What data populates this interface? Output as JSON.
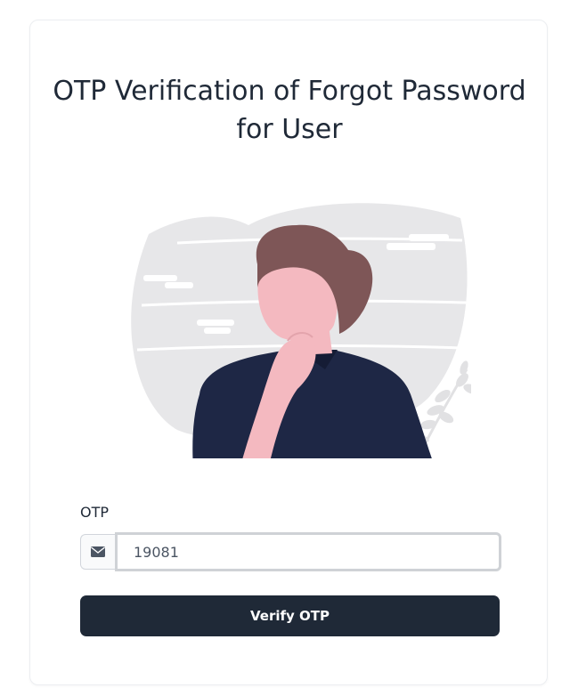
{
  "page": {
    "title": "OTP Verification of Forgot Password for User"
  },
  "form": {
    "otp_label": "OTP",
    "otp_value": "19081",
    "addon_icon": "envelope-icon",
    "submit_label": "Verify OTP"
  },
  "illustration": {
    "icon": "thinking-person-illustration"
  },
  "colors": {
    "button_bg": "#1f2937",
    "button_text": "#ffffff",
    "title_text": "#1f2937",
    "card_border": "#eceef1",
    "hair": "#7e5657",
    "skin": "#f4b9c0",
    "shirt": "#1e2745",
    "backdrop": "#e6e6e8"
  }
}
